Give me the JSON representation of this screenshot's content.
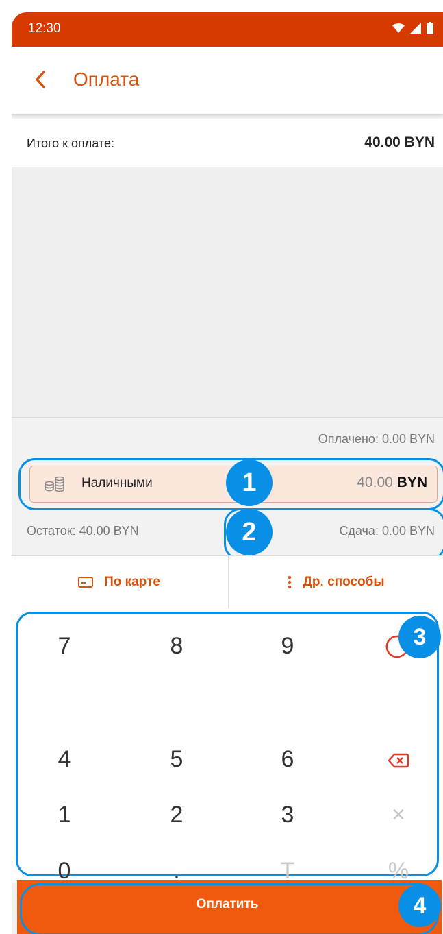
{
  "status_bar": {
    "time": "12:30"
  },
  "app_bar": {
    "title": "Оплата"
  },
  "total": {
    "label": "Итого к оплате:",
    "value": "40.00 BYN"
  },
  "paid": "Оплачено: 0.00 BYN",
  "payment_method": {
    "label": "Наличными",
    "amount": "40.00",
    "currency": "BYN"
  },
  "remaining": "Остаток: 40.00 BYN",
  "change": "Сдача: 0.00 BYN",
  "alt_methods": {
    "card_label": "По карте",
    "other_label": "Др. способы"
  },
  "keypad": {
    "rows": [
      [
        "7",
        "8",
        "9"
      ],
      [
        "4",
        "5",
        "6"
      ],
      [
        "1",
        "2",
        "3"
      ],
      [
        "0",
        ".",
        "T"
      ]
    ],
    "right_column": [
      "",
      "⌫",
      "×",
      "%"
    ]
  },
  "pay_button": {
    "label": "Оплатить"
  },
  "badges": [
    "1",
    "2",
    "3",
    "4"
  ],
  "colors": {
    "accent": "#d8520c",
    "statusbar": "#d63a00",
    "highlight": "#0a8fe6",
    "pay": "#f05a0e"
  }
}
